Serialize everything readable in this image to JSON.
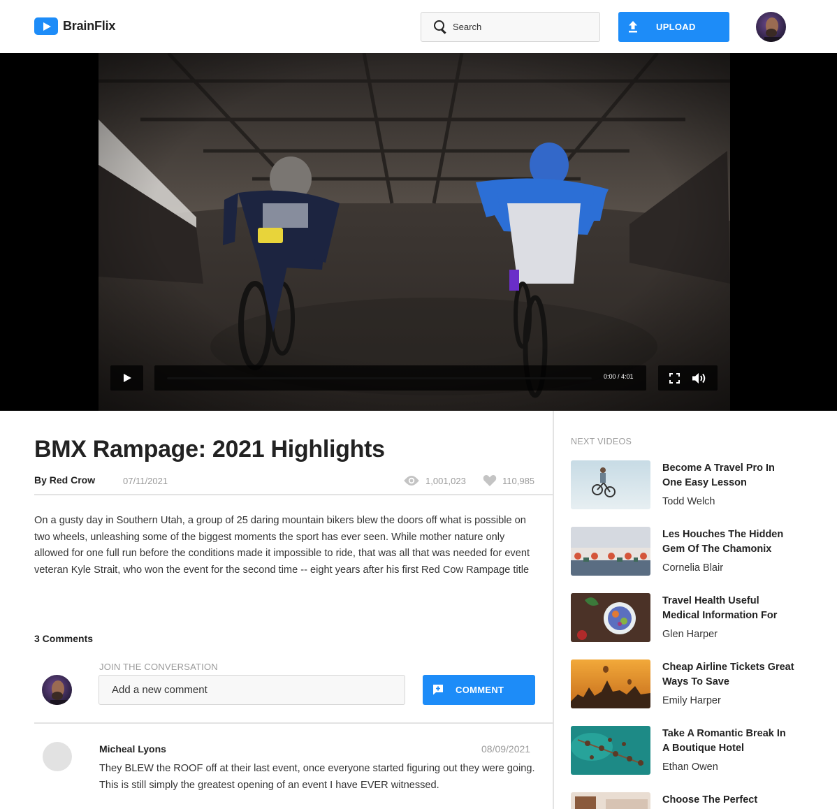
{
  "app": {
    "name": "BrainFlix",
    "accent": "#1d8cf8"
  },
  "header": {
    "search_placeholder": "Search",
    "upload_label": "UPLOAD"
  },
  "player": {
    "time": "0:00 / 4:01",
    "progress": 0
  },
  "video": {
    "title": "BMX Rampage: 2021 Highlights",
    "byline": "By Red Crow",
    "date": "07/11/2021",
    "views": "1,001,023",
    "likes": "110,985",
    "description": "On a gusty day in Southern Utah, a group of 25 daring mountain bikers blew the doors off what is possible on two wheels, unleashing some of the biggest moments the sport has ever seen. While mother nature only allowed for one full run before the conditions made it impossible to ride, that was all that was needed for event veteran Kyle Strait, who won the event for the second time -- eight years after his first Red Cow Rampage title"
  },
  "comments": {
    "count_label": "3 Comments",
    "join_label": "JOIN THE CONVERSATION",
    "input_placeholder": "Add a new comment",
    "button_label": "COMMENT",
    "items": [
      {
        "author": "Micheal Lyons",
        "date": "08/09/2021",
        "text": "They BLEW the ROOF off at their last event, once everyone started figuring out they were going. This is still simply the greatest opening of an event I have EVER witnessed."
      }
    ]
  },
  "sidebar": {
    "heading": "NEXT VIDEOS",
    "videos": [
      {
        "title": "Become A Travel Pro In One Easy Lesson",
        "author": "Todd Welch"
      },
      {
        "title": "Les Houches The Hidden Gem Of The Chamonix",
        "author": "Cornelia Blair"
      },
      {
        "title": "Travel Health Useful Medical Information For",
        "author": "Glen Harper"
      },
      {
        "title": "Cheap Airline Tickets Great Ways To Save",
        "author": "Emily Harper"
      },
      {
        "title": "Take A Romantic Break In A Boutique Hotel",
        "author": "Ethan Owen"
      },
      {
        "title": "Choose The Perfect",
        "author": ""
      }
    ]
  }
}
